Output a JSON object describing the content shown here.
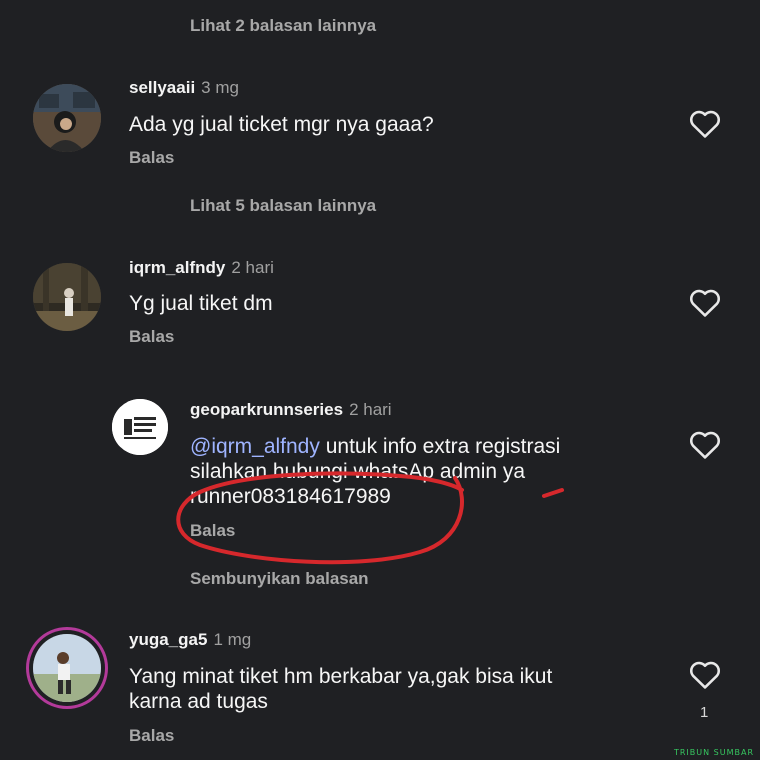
{
  "replies_top": {
    "label": "Lihat 2 balasan lainnya"
  },
  "comments": [
    {
      "username": "sellyaaii",
      "time": "3 mg",
      "lines": [
        "Ada yg jual ticket mgr nya gaaa?"
      ],
      "reply_label": "Balas"
    },
    {
      "username": "iqrm_alfndy",
      "time": "2 hari",
      "lines": [
        "Yg jual tiket dm"
      ],
      "reply_label": "Balas"
    }
  ],
  "replies_mid": {
    "label": "Lihat 5 balasan lainnya"
  },
  "reply": {
    "username": "geoparkrunnseries",
    "time": "2 hari",
    "mention": "@iqrm_alfndy",
    "line1_rest": " untuk info extra registrasi",
    "line2": "silahkan hubungi whatsAp admin ya",
    "line3": "runner083184617989",
    "reply_label": "Balas"
  },
  "hide_replies": {
    "label": "Sembunyikan balasan"
  },
  "last_comment": {
    "username": "yuga_ga5",
    "time": "1 mg",
    "line1": "Yang minat tiket hm berkabar ya,gak bisa ikut",
    "line2": "karna ad tugas",
    "reply_label": "Balas",
    "like_count": "1"
  },
  "watermark": "TRIBUN SUMBAR",
  "colors": {
    "background": "#1f2023",
    "mention": "#9fb4ff",
    "annotation": "#d6282c",
    "story_ring": "#b33a9a"
  },
  "icons": [
    "heart-outline-icon"
  ]
}
